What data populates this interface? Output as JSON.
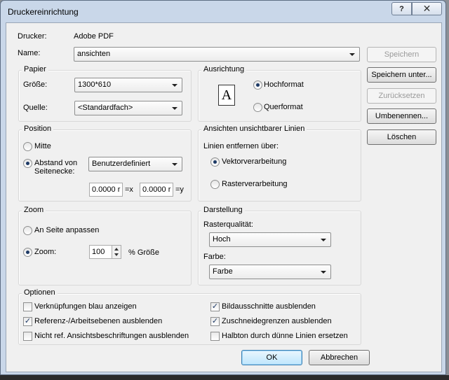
{
  "window": {
    "title": "Druckereinrichtung",
    "help_glyph": "?",
    "close_glyph": "✕"
  },
  "printer": {
    "label": "Drucker:",
    "value": "Adobe PDF"
  },
  "name": {
    "label": "Name:",
    "value": "ansichten"
  },
  "buttons": {
    "save": "Speichern",
    "save_as": "Speichern unter...",
    "reset": "Zurücksetzen",
    "rename": "Umbenennen...",
    "delete": "Löschen",
    "ok": "OK",
    "cancel": "Abbrechen"
  },
  "paper": {
    "title": "Papier",
    "size_label": "Größe:",
    "size_value": "1300*610",
    "source_label": "Quelle:",
    "source_value": "<Standardfach>"
  },
  "orientation": {
    "title": "Ausrichtung",
    "icon_glyph": "A",
    "portrait": "Hochformat",
    "landscape": "Querformat",
    "selected": "portrait"
  },
  "position": {
    "title": "Position",
    "center": "Mitte",
    "offset": "Abstand von Seitenecke:",
    "offset_type": "Benutzerdefiniert",
    "x_value": "0.0000 r",
    "x_unit": "=x",
    "y_value": "0.0000 r",
    "y_unit": "=y"
  },
  "hidden_lines": {
    "title": "Ansichten unsichtbarer Linien",
    "remove_label": "Linien entfernen über:",
    "vector": "Vektorverarbeitung",
    "raster": "Rasterverarbeitung"
  },
  "zoom": {
    "title": "Zoom",
    "fit": "An Seite anpassen",
    "zoom_label": "Zoom:",
    "value": "100",
    "unit": "% Größe"
  },
  "display": {
    "title": "Darstellung",
    "raster_quality_label": "Rasterqualität:",
    "raster_quality_value": "Hoch",
    "color_label": "Farbe:",
    "color_value": "Farbe"
  },
  "options": {
    "title": "Optionen",
    "items": [
      {
        "label": "Verknüpfungen blau anzeigen",
        "checked": false
      },
      {
        "label": "Referenz-/Arbeitsebenen ausblenden",
        "checked": true
      },
      {
        "label": "Nicht ref. Ansichtsbeschriftungen ausblenden",
        "checked": false
      },
      {
        "label": "Bildausschnitte ausblenden",
        "checked": true
      },
      {
        "label": "Zuschneidegrenzen ausblenden",
        "checked": true
      },
      {
        "label": "Halbton durch dünne Linien ersetzen",
        "checked": false
      }
    ],
    "check_glyph": "✓"
  },
  "colors": {
    "accent": "#1d3a66",
    "frame": "#c9d7e9",
    "client": "#f0f0f0"
  }
}
